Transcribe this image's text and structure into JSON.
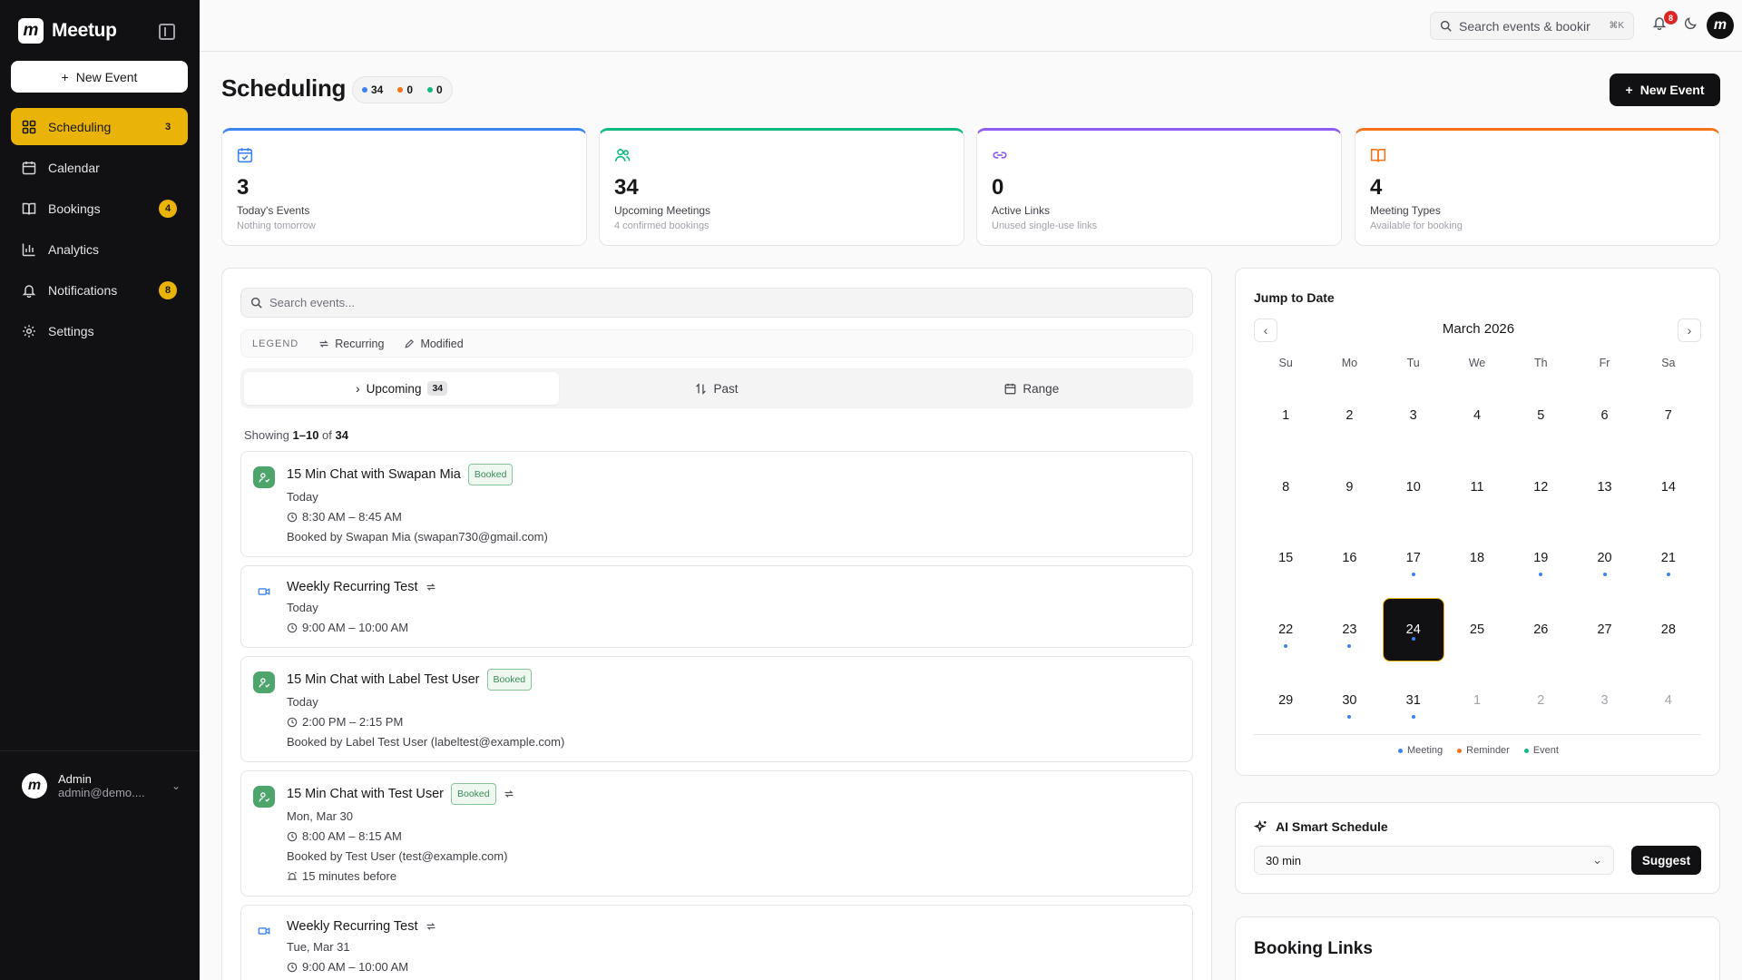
{
  "brand": {
    "name": "Meetup",
    "logo_letter": "m"
  },
  "sidebar": {
    "new_event_label": "New Event",
    "items": [
      {
        "label": "Scheduling",
        "badge": "3",
        "icon": "grid-icon",
        "active": true
      },
      {
        "label": "Calendar",
        "badge": "",
        "icon": "calendar-icon",
        "active": false
      },
      {
        "label": "Bookings",
        "badge": "4",
        "icon": "book-icon",
        "active": false
      },
      {
        "label": "Analytics",
        "badge": "",
        "icon": "bar-chart-icon",
        "active": false
      },
      {
        "label": "Notifications",
        "badge": "8",
        "icon": "bell-icon",
        "active": false
      },
      {
        "label": "Settings",
        "badge": "",
        "icon": "gear-icon",
        "active": false
      }
    ],
    "user": {
      "name": "Admin",
      "email": "admin@demo...."
    }
  },
  "topbar": {
    "search_placeholder": "Search events & bookir",
    "shortcut": "⌘K",
    "notification_count": "8"
  },
  "header": {
    "title": "Scheduling",
    "counts": [
      {
        "value": "34",
        "color": "#3b82f6"
      },
      {
        "value": "0",
        "color": "#f97316"
      },
      {
        "value": "0",
        "color": "#10b981"
      }
    ],
    "new_event_label": "New Event"
  },
  "stats": [
    {
      "value": "3",
      "label": "Today's Events",
      "sub": "Nothing tomorrow",
      "color": "#3b82f6",
      "icon": "calendar-check-icon"
    },
    {
      "value": "34",
      "label": "Upcoming Meetings",
      "sub": "4 confirmed bookings",
      "color": "#10b981",
      "icon": "users-icon"
    },
    {
      "value": "0",
      "label": "Active Links",
      "sub": "Unused single-use links",
      "color": "#8b5cf6",
      "icon": "link-icon"
    },
    {
      "value": "4",
      "label": "Meeting Types",
      "sub": "Available for booking",
      "color": "#f97316",
      "icon": "book-open-icon"
    }
  ],
  "events_panel": {
    "search_placeholder": "Search events...",
    "legend": {
      "title": "LEGEND",
      "recurring": "Recurring",
      "modified": "Modified"
    },
    "tabs": [
      {
        "label": "Upcoming",
        "count": "34",
        "active": true
      },
      {
        "label": "Past",
        "count": "",
        "active": false
      },
      {
        "label": "Range",
        "count": "",
        "active": false
      }
    ],
    "showing": {
      "prefix": "Showing",
      "range": "1–10",
      "of": "of",
      "total": "34"
    },
    "events": [
      {
        "title": "15 Min Chat with Swapan Mia",
        "badge": "Booked",
        "recurring": false,
        "kind": "booked",
        "date": "Today",
        "time": "8:30 AM – 8:45 AM",
        "booked_by": "Booked by Swapan Mia (swapan730@gmail.com)",
        "reminder": ""
      },
      {
        "title": "Weekly Recurring Test",
        "badge": "",
        "recurring": true,
        "kind": "video",
        "date": "Today",
        "time": "9:00 AM – 10:00 AM",
        "booked_by": "",
        "reminder": ""
      },
      {
        "title": "15 Min Chat with Label Test User",
        "badge": "Booked",
        "recurring": false,
        "kind": "booked",
        "date": "Today",
        "time": "2:00 PM – 2:15 PM",
        "booked_by": "Booked by Label Test User (labeltest@example.com)",
        "reminder": ""
      },
      {
        "title": "15 Min Chat with Test User",
        "badge": "Booked",
        "recurring": true,
        "kind": "booked",
        "date": "Mon, Mar 30",
        "time": "8:00 AM – 8:15 AM",
        "booked_by": "Booked by Test User (test@example.com)",
        "reminder": "15 minutes before"
      },
      {
        "title": "Weekly Recurring Test",
        "badge": "",
        "recurring": true,
        "kind": "video",
        "date": "Tue, Mar 31",
        "time": "9:00 AM – 10:00 AM",
        "booked_by": "",
        "reminder": ""
      }
    ]
  },
  "calendar": {
    "title": "Jump to Date",
    "month": "March 2026",
    "weekdays": [
      "Su",
      "Mo",
      "Tu",
      "We",
      "Th",
      "Fr",
      "Sa"
    ],
    "days": [
      {
        "d": "1"
      },
      {
        "d": "2"
      },
      {
        "d": "3"
      },
      {
        "d": "4"
      },
      {
        "d": "5"
      },
      {
        "d": "6"
      },
      {
        "d": "7"
      },
      {
        "d": "8"
      },
      {
        "d": "9"
      },
      {
        "d": "10"
      },
      {
        "d": "11"
      },
      {
        "d": "12"
      },
      {
        "d": "13"
      },
      {
        "d": "14"
      },
      {
        "d": "15"
      },
      {
        "d": "16"
      },
      {
        "d": "17",
        "dot": true
      },
      {
        "d": "18"
      },
      {
        "d": "19",
        "dot": true
      },
      {
        "d": "20",
        "dot": true
      },
      {
        "d": "21",
        "dot": true
      },
      {
        "d": "22",
        "dot": true
      },
      {
        "d": "23",
        "dot": true
      },
      {
        "d": "24",
        "dot": true,
        "today": true
      },
      {
        "d": "25"
      },
      {
        "d": "26"
      },
      {
        "d": "27"
      },
      {
        "d": "28"
      },
      {
        "d": "29"
      },
      {
        "d": "30",
        "dot": true
      },
      {
        "d": "31",
        "dot": true
      },
      {
        "d": "1",
        "muted": true
      },
      {
        "d": "2",
        "muted": true
      },
      {
        "d": "3",
        "muted": true
      },
      {
        "d": "4",
        "muted": true
      }
    ],
    "legend": [
      {
        "label": "Meeting",
        "color": "#3b82f6"
      },
      {
        "label": "Reminder",
        "color": "#f97316"
      },
      {
        "label": "Event",
        "color": "#10b981"
      }
    ]
  },
  "ai_schedule": {
    "title": "AI Smart Schedule",
    "duration": "30 min",
    "button": "Suggest"
  },
  "booking_links": {
    "title": "Booking Links"
  }
}
